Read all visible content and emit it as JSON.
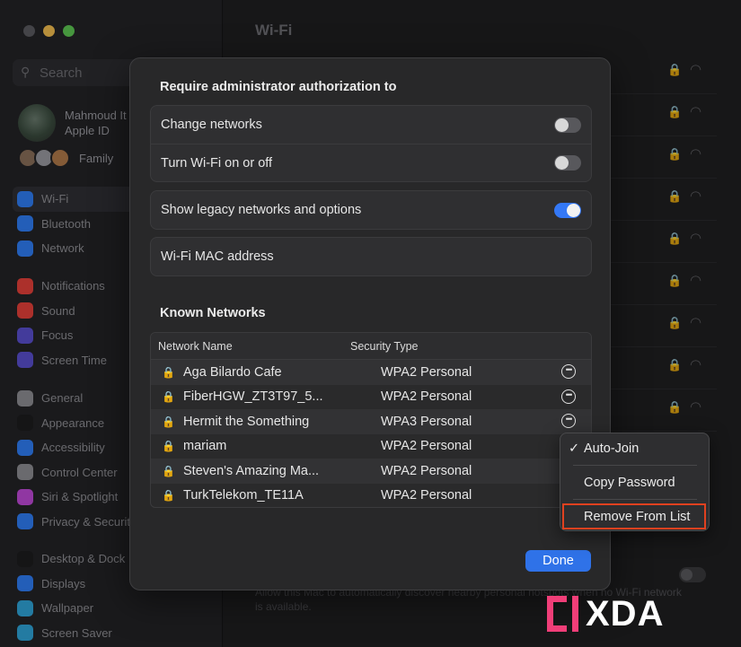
{
  "colors": {
    "accent": "#3478f6",
    "highlight": "#e0411f",
    "brand": "#f03e78"
  },
  "sidebar": {
    "search_placeholder": "Search",
    "account": {
      "name": "Mahmoud It",
      "sub": "Apple ID"
    },
    "family_label": "Family",
    "groups": [
      [
        {
          "label": "Wi-Fi",
          "icon": "wifi-icon",
          "color": "#2f7ef6",
          "active": true
        },
        {
          "label": "Bluetooth",
          "icon": "bluetooth-icon",
          "color": "#2f7ef6"
        },
        {
          "label": "Network",
          "icon": "globe-icon",
          "color": "#2f7ef6"
        }
      ],
      [
        {
          "label": "Notifications",
          "icon": "bell-icon",
          "color": "#e6413a"
        },
        {
          "label": "Sound",
          "icon": "speaker-icon",
          "color": "#e6413a"
        },
        {
          "label": "Focus",
          "icon": "moon-icon",
          "color": "#5a4fcf"
        },
        {
          "label": "Screen Time",
          "icon": "hourglass-icon",
          "color": "#5a4fcf"
        }
      ],
      [
        {
          "label": "General",
          "icon": "gear-icon",
          "color": "#8e8e93"
        },
        {
          "label": "Appearance",
          "icon": "appearance-icon",
          "color": "#1c1c1e"
        },
        {
          "label": "Accessibility",
          "icon": "accessibility-icon",
          "color": "#2f7ef6"
        },
        {
          "label": "Control Center",
          "icon": "control-center-icon",
          "color": "#8e8e93"
        },
        {
          "label": "Siri & Spotlight",
          "icon": "siri-icon",
          "color": "#c04ad8"
        },
        {
          "label": "Privacy & Security",
          "icon": "hand-icon",
          "color": "#2f7ef6"
        }
      ],
      [
        {
          "label": "Desktop & Dock",
          "icon": "dock-icon",
          "color": "#1c1c1e"
        },
        {
          "label": "Displays",
          "icon": "sun-icon",
          "color": "#2f7ef6"
        },
        {
          "label": "Wallpaper",
          "icon": "flower-icon",
          "color": "#2fa4d8"
        },
        {
          "label": "Screen Saver",
          "icon": "screensaver-icon",
          "color": "#2fa4d8"
        }
      ]
    ]
  },
  "main": {
    "title": "Wi-Fi",
    "bottom_text": "Allow this Mac to automatically discover nearby personal hotspots when no Wi-Fi network is available."
  },
  "sheet": {
    "auth_title": "Require administrator authorization to",
    "auth_options": [
      {
        "label": "Change networks",
        "on": false
      },
      {
        "label": "Turn Wi-Fi on or off",
        "on": false
      }
    ],
    "legacy": {
      "label": "Show legacy networks and options",
      "on": true
    },
    "mac_address_label": "Wi-Fi MAC address",
    "known_title": "Known Networks",
    "table_headers": {
      "name": "Network Name",
      "security": "Security Type"
    },
    "networks": [
      {
        "name": "Aga Bilardo Cafe",
        "security": "WPA2 Personal",
        "more": true
      },
      {
        "name": "FiberHGW_ZT3T97_5...",
        "security": "WPA2 Personal",
        "more": true
      },
      {
        "name": "Hermit the Something",
        "security": "WPA3 Personal",
        "more": true
      },
      {
        "name": "mariam",
        "security": "WPA2 Personal",
        "more": false
      },
      {
        "name": "Steven's Amazing Ma...",
        "security": "WPA2 Personal",
        "more": false
      },
      {
        "name": "TurkTelekom_TE11A",
        "security": "WPA2 Personal",
        "more": false
      }
    ],
    "done_label": "Done"
  },
  "context_menu": {
    "items": [
      {
        "label": "Auto-Join",
        "checked": true
      },
      {
        "label": "Copy Password",
        "checked": false
      },
      {
        "label": "Remove From List",
        "checked": false,
        "highlighted": true
      }
    ]
  },
  "watermark": {
    "text": "XDA"
  }
}
